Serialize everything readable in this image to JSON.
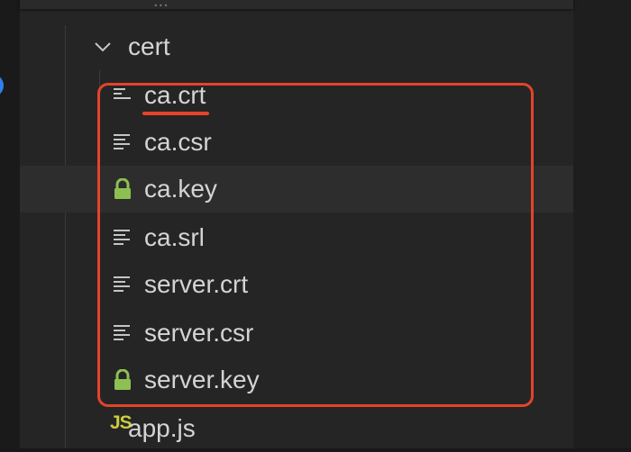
{
  "explorer": {
    "folder": {
      "name": "cert",
      "expanded": true,
      "chevron_icon": "chevron-down-icon",
      "files": [
        {
          "name": "ca.crt",
          "icon": "file-lines-icon"
        },
        {
          "name": "ca.csr",
          "icon": "file-lines-icon"
        },
        {
          "name": "ca.key",
          "icon": "lock-icon"
        },
        {
          "name": "ca.srl",
          "icon": "file-lines-icon"
        },
        {
          "name": "server.crt",
          "icon": "file-lines-icon"
        },
        {
          "name": "server.csr",
          "icon": "file-lines-icon"
        },
        {
          "name": "server.key",
          "icon": "lock-icon"
        }
      ]
    },
    "sibling_file": {
      "name": "app.js",
      "badge": "JS"
    },
    "highlighted_range": "ca.crt - server.key"
  },
  "colors": {
    "panel_bg": "#252526",
    "text": "#d4d4d4",
    "lock_icon": "#8cc152",
    "js_badge": "#cbcb41",
    "annotation": "#e5432a"
  }
}
